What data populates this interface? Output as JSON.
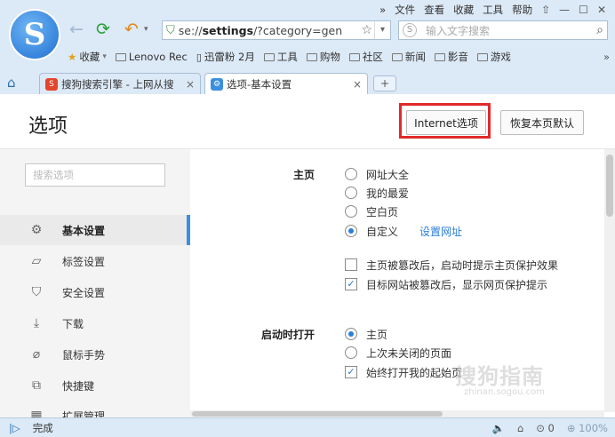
{
  "browser": {
    "menu": [
      "文件",
      "查看",
      "收藏",
      "工具",
      "帮助"
    ],
    "menu_more": "»",
    "url_prefix": "se://",
    "url_bold": "settings",
    "url_rest": "/?category=gen",
    "search_placeholder": "输入文字搜索",
    "bookmarks": [
      "收藏",
      "Lenovo Rec",
      "迅雷粉 2月",
      "工具",
      "购物",
      "社区",
      "新闻",
      "影音",
      "游戏"
    ],
    "bookmarks_more": "»",
    "tabs": [
      {
        "label": "搜狗搜索引擎 - 上网从搜",
        "close": "×"
      },
      {
        "label": "选项-基本设置",
        "close": "×"
      }
    ],
    "new_tab": "+"
  },
  "page": {
    "title": "选项",
    "internet_button": "Internet选项",
    "restore_button": "恢复本页默认"
  },
  "sidebar": {
    "search_placeholder": "搜索选项",
    "items": [
      {
        "label": "基本设置",
        "icon": "gear-icon"
      },
      {
        "label": "标签设置",
        "icon": "tab-icon"
      },
      {
        "label": "安全设置",
        "icon": "shield-icon"
      },
      {
        "label": "下载",
        "icon": "download-icon"
      },
      {
        "label": "鼠标手势",
        "icon": "mouse-icon"
      },
      {
        "label": "快捷键",
        "icon": "shortcut-icon"
      },
      {
        "label": "扩展管理",
        "icon": "extension-icon"
      }
    ]
  },
  "homepage": {
    "label": "主页",
    "options": [
      "网址大全",
      "我的最爱",
      "空白页",
      "自定义"
    ],
    "selected": "自定义",
    "set_url_link": "设置网址",
    "checks": [
      {
        "label": "主页被篡改后，启动时提示主页保护效果",
        "checked": false
      },
      {
        "label": "目标网站被篡改后，显示网页保护提示",
        "checked": true
      }
    ]
  },
  "startup": {
    "label": "启动时打开",
    "options": [
      "主页",
      "上次未关闭的页面"
    ],
    "selected": "主页",
    "check": {
      "label": "始终打开我的起始页",
      "checked": true
    }
  },
  "watermark": {
    "text": "搜狗指南",
    "sub": "zhinan.sogou.com"
  },
  "status": {
    "text": "完成",
    "count": "0",
    "zoom": "100%"
  }
}
